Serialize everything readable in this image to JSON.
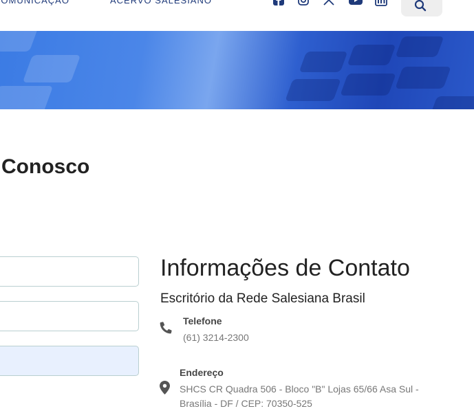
{
  "nav": {
    "links": [
      "COMUNICAÇÃO",
      "ACERVO SALESIANO"
    ],
    "social_icons": [
      "facebook-icon",
      "instagram-icon",
      "x-twitter-icon",
      "youtube-icon",
      "linkedin-icon"
    ],
    "search_icon": "search-icon"
  },
  "page": {
    "title": "Conosco"
  },
  "form": {
    "field_values": [
      "",
      "",
      ""
    ]
  },
  "contact": {
    "heading": "Informações de Contato",
    "office": "Escritório da Rede Salesiana Brasil",
    "phone": {
      "label": "Telefone",
      "value": "(61) 3214-2300",
      "icon": "phone-icon"
    },
    "address": {
      "label": "Endereço",
      "line1": "SHCS CR Quadra 506 - Bloco \"B\" Lojas 65/66 Asa Sul -",
      "line2": "Brasília - DF / CEP: 70350-525",
      "icon": "map-pin-icon"
    }
  },
  "colors": {
    "nav_text": "#1f3a7a",
    "banner_blue": "#2e5fcf",
    "field_border": "#b9cfd0",
    "autofill_bg": "#e8f0fe"
  }
}
